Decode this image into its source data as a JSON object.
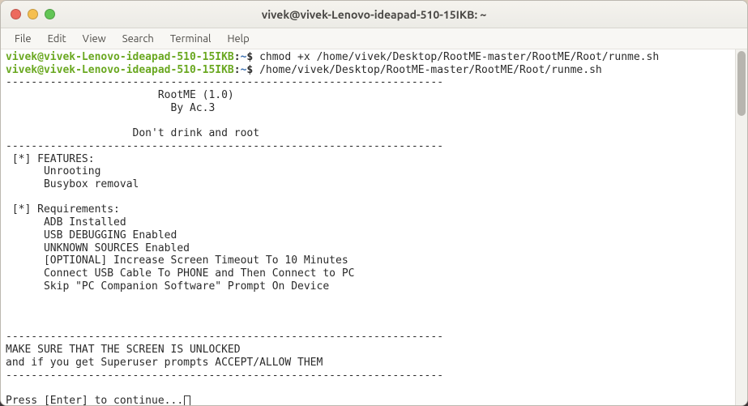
{
  "window": {
    "title": "vivek@vivek-Lenovo-ideapad-510-15IKB: ~"
  },
  "menubar": {
    "items": [
      "File",
      "Edit",
      "View",
      "Search",
      "Terminal",
      "Help"
    ]
  },
  "prompt": {
    "user_host": "vivek@vivek-Lenovo-ideapad-510-15IKB",
    "sep": ":",
    "path": "~",
    "symbol": "$"
  },
  "commands": {
    "cmd1": "chmod +x /home/vivek/Desktop/RootME-master/RootME/Root/runme.sh",
    "cmd2": "/home/vivek/Desktop/RootME-master/RootME/Root/runme.sh"
  },
  "output": {
    "dash_top": "---------------------------------------------------------------------",
    "title_line": "                        RootME (1.0)",
    "author_line": "                          By Ac.3",
    "blank": "",
    "slogan": "                    Don't drink and root",
    "dash_mid": "---------------------------------------------------------------------",
    "features_hdr": " [*] FEATURES:",
    "feat1": "      Unrooting",
    "feat2": "      Busybox removal",
    "reqs_hdr": " [*] Requirements:",
    "req1": "      ADB Installed",
    "req2": "      USB DEBUGGING Enabled",
    "req3": "      UNKNOWN SOURCES Enabled",
    "req4": "      [OPTIONAL] Increase Screen Timeout To 10 Minutes",
    "req5": "      Connect USB Cable To PHONE and Then Connect to PC",
    "req6": "      Skip \"PC Companion Software\" Prompt On Device",
    "dash_mid2": "---------------------------------------------------------------------",
    "warn1": "MAKE SURE THAT THE SCREEN IS UNLOCKED",
    "warn2": "and if you get Superuser prompts ACCEPT/ALLOW THEM",
    "dash_bot": "---------------------------------------------------------------------",
    "press_enter": "Press [Enter] to continue..."
  }
}
